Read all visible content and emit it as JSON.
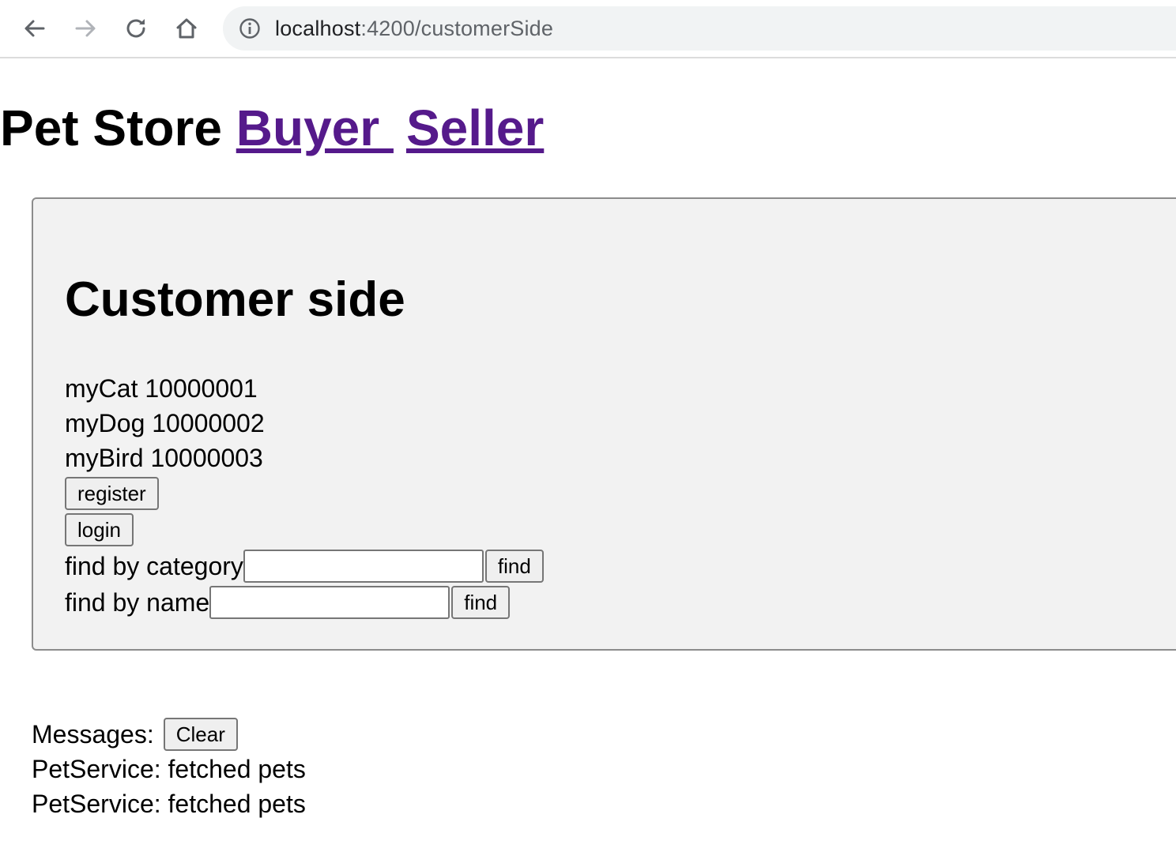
{
  "browser": {
    "url_host": "localhost",
    "url_path": ":4200/customerSide"
  },
  "header": {
    "title": "Pet Store",
    "links": [
      {
        "label": "Buyer "
      },
      {
        "label": "Seller"
      }
    ]
  },
  "customer": {
    "heading": "Customer side",
    "pets": [
      {
        "name": "myCat",
        "id": "10000001"
      },
      {
        "name": "myDog",
        "id": "10000002"
      },
      {
        "name": "myBird",
        "id": "10000003"
      }
    ],
    "register_label": "register",
    "login_label": "login",
    "find_by_category_label": "find by category",
    "find_by_category_value": "",
    "find_by_name_label": "find by name",
    "find_by_name_value": "",
    "find_button_label": "find"
  },
  "messages": {
    "label": "Messages:",
    "clear_label": "Clear",
    "items": [
      "PetService: fetched pets",
      "PetService: fetched pets"
    ]
  }
}
